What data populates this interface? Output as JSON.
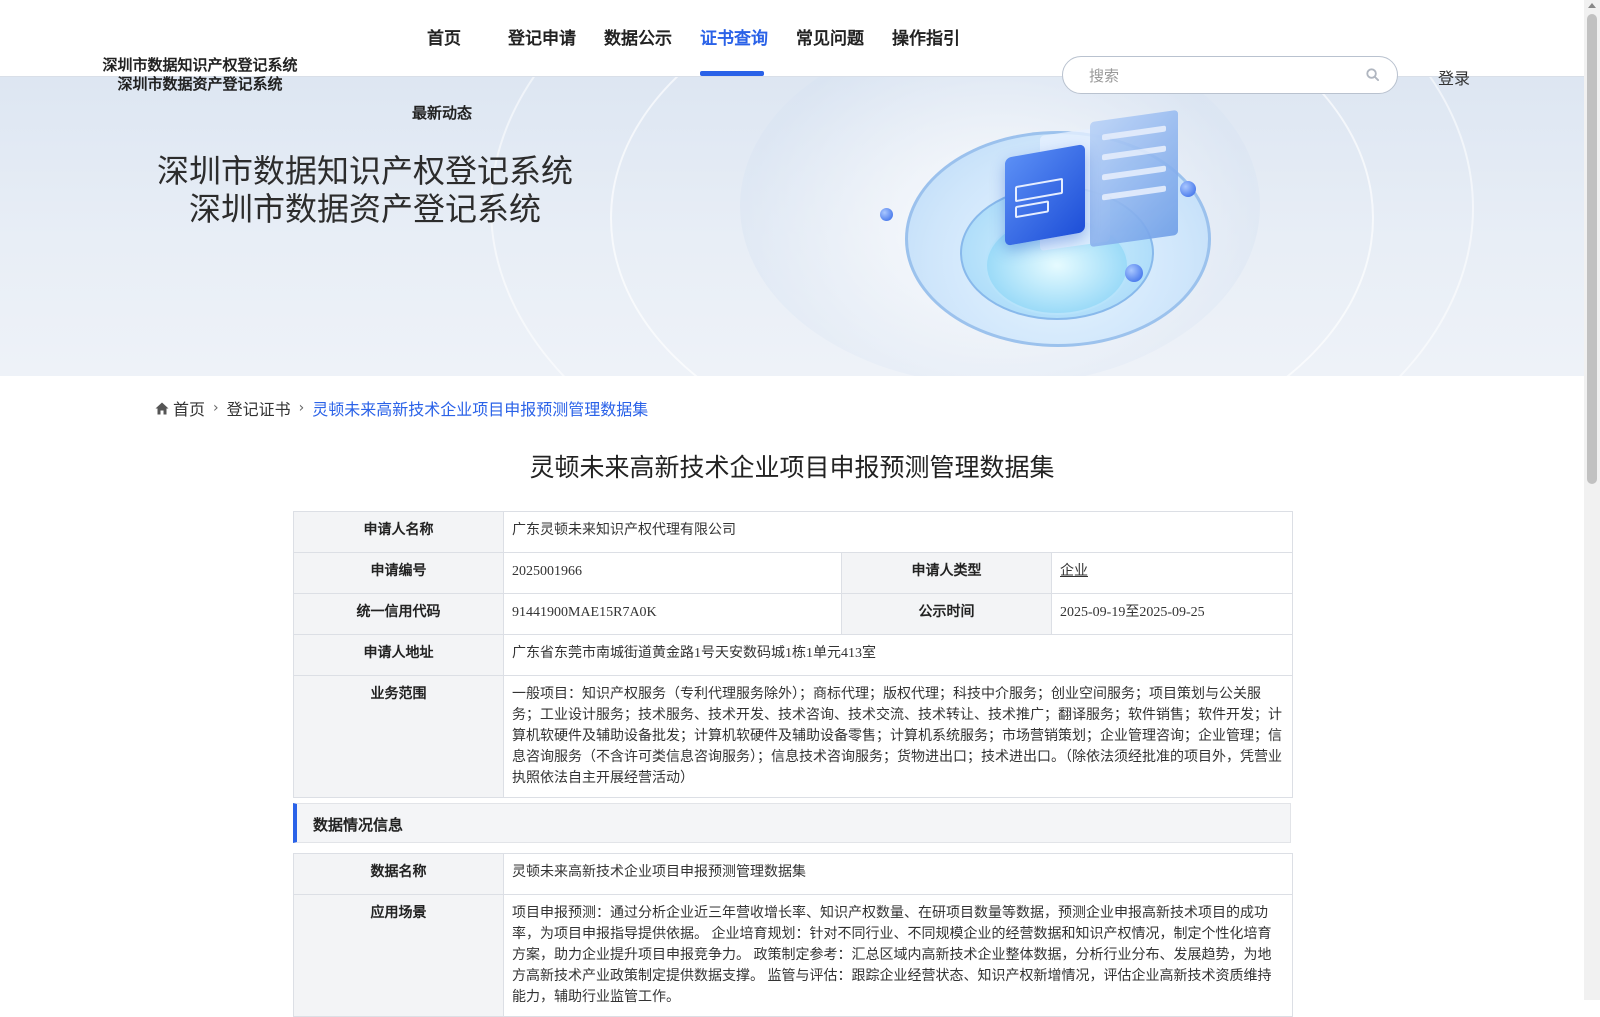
{
  "header": {
    "logo_line1": "深圳市数据知识产权登记系统",
    "logo_line2": "深圳市数据资产登记系统",
    "nav": [
      {
        "label": "首页",
        "active": false
      },
      {
        "label": "登记申请",
        "active": false
      },
      {
        "label": "数据公示",
        "active": false
      },
      {
        "label": "证书查询",
        "active": true
      },
      {
        "label": "常见问题",
        "active": false
      },
      {
        "label": "操作指引",
        "active": false
      }
    ],
    "subnav_label": "最新动态",
    "search_placeholder": "搜索",
    "login_label": "登录",
    "accent_color": "#2a62e8"
  },
  "hero": {
    "title_line1": "深圳市数据知识产权登记系统",
    "title_line2": "深圳市数据资产登记系统"
  },
  "breadcrumb": {
    "home": "首页",
    "level2": "登记证书",
    "current": "灵顿未来高新技术企业项目申报预测管理数据集"
  },
  "page_title": "灵顿未来高新技术企业项目申报预测管理数据集",
  "applicant": {
    "name_label": "申请人名称",
    "name_value": "广东灵顿未来知识产权代理有限公司",
    "no_label": "申请编号",
    "no_value": "2025001966",
    "type_label": "申请人类型",
    "type_value": "企业",
    "credit_label": "统一信用代码",
    "credit_value": "91441900MAE15R7A0K",
    "period_label": "公示时间",
    "period_value": "2025-09-19至2025-09-25",
    "address_label": "申请人地址",
    "address_value": "广东省东莞市南城街道黄金路1号天安数码城1栋1单元413室",
    "scope_label": "业务范围",
    "scope_value": "一般项目：知识产权服务（专利代理服务除外）；商标代理；版权代理；科技中介服务；创业空间服务；项目策划与公关服务；工业设计服务；技术服务、技术开发、技术咨询、技术交流、技术转让、技术推广；翻译服务；软件销售；软件开发；计算机软硬件及辅助设备批发；计算机软硬件及辅助设备零售；计算机系统服务；市场营销策划；企业管理咨询；企业管理；信息咨询服务（不含许可类信息咨询服务）；信息技术咨询服务；货物进出口；技术进出口。（除依法须经批准的项目外，凭营业执照依法自主开展经营活动）"
  },
  "data_section": {
    "title": "数据情况信息",
    "data_name_label": "数据名称",
    "data_name_value": "灵顿未来高新技术企业项目申报预测管理数据集",
    "scenario_label": "应用场景",
    "scenario_value": "项目申报预测：通过分析企业近三年营收增长率、知识产权数量、在研项目数量等数据，预测企业申报高新技术项目的成功率，为项目申报指导提供依据。 企业培育规划：针对不同行业、不同规模企业的经营数据和知识产权情况，制定个性化培育方案，助力企业提升项目申报竞争力。 政策制定参考：汇总区域内高新技术企业整体数据，分析行业分布、发展趋势，为地方高新技术产业政策制定提供数据支撑。 监管与评估：跟踪企业经营状态、知识产权新增情况，评估企业高新技术资质维持能力，辅助行业监管工作。"
  }
}
